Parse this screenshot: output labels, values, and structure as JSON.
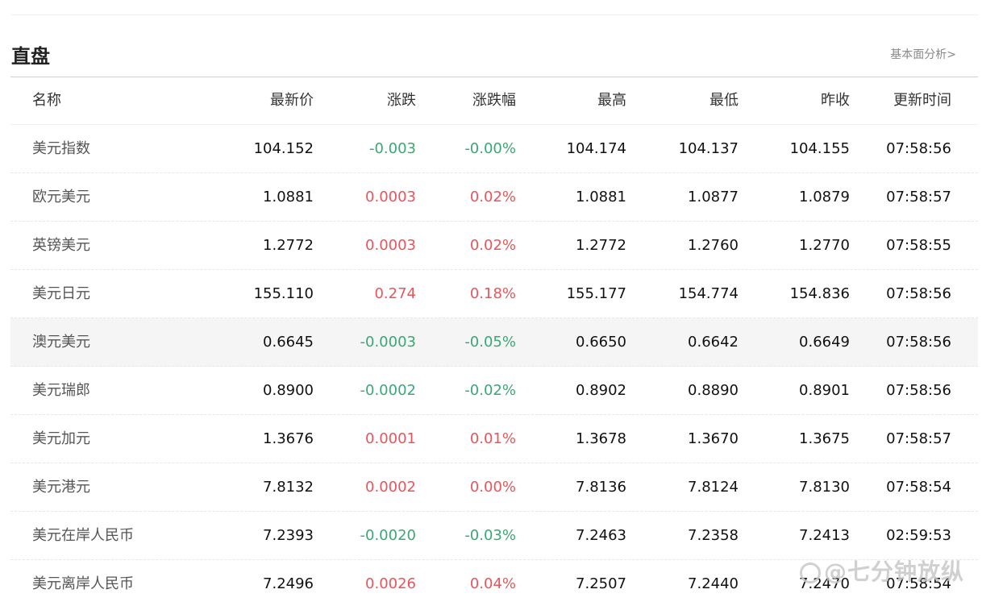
{
  "section": {
    "title": "直盘",
    "more_link": "基本面分析>"
  },
  "table": {
    "headers": {
      "name": "名称",
      "last": "最新价",
      "change": "涨跌",
      "change_pct": "涨跌幅",
      "high": "最高",
      "low": "最低",
      "prev_close": "昨收",
      "time": "更新时间"
    },
    "rows": [
      {
        "name": "美元指数",
        "last": "104.152",
        "change": "-0.003",
        "change_pct": "-0.00%",
        "high": "104.174",
        "low": "104.137",
        "prev_close": "104.155",
        "time": "07:58:56",
        "direction": "down"
      },
      {
        "name": "欧元美元",
        "last": "1.0881",
        "change": "0.0003",
        "change_pct": "0.02%",
        "high": "1.0881",
        "low": "1.0877",
        "prev_close": "1.0879",
        "time": "07:58:57",
        "direction": "up"
      },
      {
        "name": "英镑美元",
        "last": "1.2772",
        "change": "0.0003",
        "change_pct": "0.02%",
        "high": "1.2772",
        "low": "1.2760",
        "prev_close": "1.2770",
        "time": "07:58:55",
        "direction": "up"
      },
      {
        "name": "美元日元",
        "last": "155.110",
        "change": "0.274",
        "change_pct": "0.18%",
        "high": "155.177",
        "low": "154.774",
        "prev_close": "154.836",
        "time": "07:58:56",
        "direction": "up"
      },
      {
        "name": "澳元美元",
        "last": "0.6645",
        "change": "-0.0003",
        "change_pct": "-0.05%",
        "high": "0.6650",
        "low": "0.6642",
        "prev_close": "0.6649",
        "time": "07:58:56",
        "direction": "down",
        "highlighted": true
      },
      {
        "name": "美元瑞郎",
        "last": "0.8900",
        "change": "-0.0002",
        "change_pct": "-0.02%",
        "high": "0.8902",
        "low": "0.8890",
        "prev_close": "0.8901",
        "time": "07:58:56",
        "direction": "down"
      },
      {
        "name": "美元加元",
        "last": "1.3676",
        "change": "0.0001",
        "change_pct": "0.01%",
        "high": "1.3678",
        "low": "1.3670",
        "prev_close": "1.3675",
        "time": "07:58:57",
        "direction": "up"
      },
      {
        "name": "美元港元",
        "last": "7.8132",
        "change": "0.0002",
        "change_pct": "0.00%",
        "high": "7.8136",
        "low": "7.8124",
        "prev_close": "7.8130",
        "time": "07:58:54",
        "direction": "up"
      },
      {
        "name": "美元在岸人民币",
        "last": "7.2393",
        "change": "-0.0020",
        "change_pct": "-0.03%",
        "high": "7.2463",
        "low": "7.2358",
        "prev_close": "7.2413",
        "time": "02:59:53",
        "direction": "down"
      },
      {
        "name": "美元离岸人民币",
        "last": "7.2496",
        "change": "0.0026",
        "change_pct": "0.04%",
        "high": "7.2507",
        "low": "7.2440",
        "prev_close": "7.2470",
        "time": "07:58:54",
        "direction": "up"
      }
    ]
  },
  "colors": {
    "up": "#e8555b",
    "down": "#3aa876"
  },
  "watermark": {
    "text": "@七分钟放纵"
  }
}
